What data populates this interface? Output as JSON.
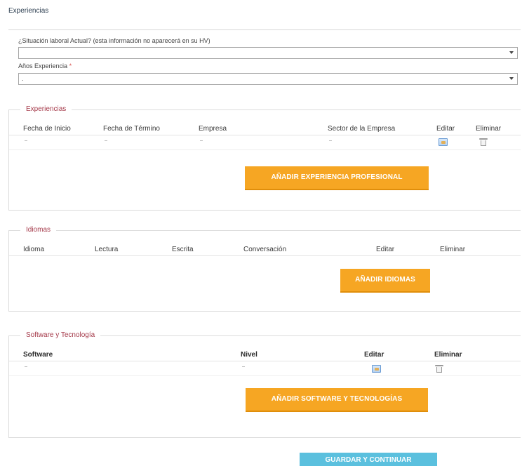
{
  "page": {
    "title": "Experiencias"
  },
  "form": {
    "situacion_label": "¿Situación laboral Actual? (esta información no aparecerá en su HV)",
    "situacion_value": "",
    "anios_label": "Años Experiencia",
    "anios_required": "*",
    "anios_value": "."
  },
  "experiencias": {
    "legend": "Experiencias",
    "columns": [
      "Fecha de Inicio",
      "Fecha de Término",
      "Empresa",
      "Sector de la Empresa",
      "Editar",
      "Eliminar"
    ],
    "add_button": "AÑADIR EXPERIENCIA PROFESIONAL"
  },
  "idiomas": {
    "legend": "Idiomas",
    "columns": [
      "Idioma",
      "Lectura",
      "Escrita",
      "Conversación",
      "Editar",
      "Eliminar"
    ],
    "add_button": "AÑADIR IDIOMAS"
  },
  "software": {
    "legend": "Software y Tecnología",
    "columns": [
      "Software",
      "Nivel",
      "Editar",
      "Eliminar"
    ],
    "add_button": "AÑADIR SOFTWARE Y TECNOLOGÍAS"
  },
  "footer": {
    "save_button": "GUARDAR Y CONTINUAR"
  },
  "colors": {
    "orange_button": "#f6a623",
    "blue_button": "#5bc0de",
    "legend_text": "#a53a4a"
  }
}
